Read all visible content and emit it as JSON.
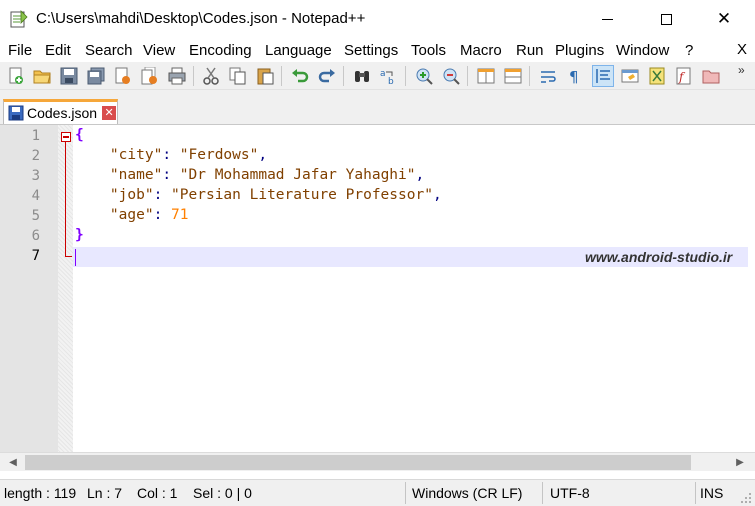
{
  "window": {
    "title": "C:\\Users\\mahdi\\Desktop\\Codes.json - Notepad++"
  },
  "menu": {
    "items": [
      "File",
      "Edit",
      "Search",
      "View",
      "Encoding",
      "Language",
      "Settings",
      "Tools",
      "Macro",
      "Run",
      "Plugins",
      "Window",
      "?"
    ],
    "close": "X"
  },
  "toolbar": {
    "buttons": [
      "new-file",
      "open-file",
      "save",
      "save-all",
      "close",
      "close-all",
      "print",
      "cut",
      "copy",
      "paste",
      "undo",
      "redo",
      "find",
      "replace",
      "zoom-in",
      "zoom-out",
      "sync-vertical",
      "sync-horizontal",
      "word-wrap",
      "show-all-characters",
      "indent-guide",
      "user-defined-language",
      "doc-map",
      "function-list",
      "folder-as-workspace"
    ],
    "more": "»"
  },
  "tab": {
    "label": "Codes.json",
    "close": "✕"
  },
  "editor": {
    "line_numbers": [
      "1",
      "2",
      "3",
      "4",
      "5",
      "6",
      "7"
    ],
    "lines": [
      {
        "parts": [
          {
            "t": "brace",
            "v": "{"
          }
        ]
      },
      {
        "parts": [
          {
            "t": "plain",
            "v": "    "
          },
          {
            "t": "key",
            "v": "\"city\""
          },
          {
            "t": "punct",
            "v": ": "
          },
          {
            "t": "str",
            "v": "\"Ferdows\""
          },
          {
            "t": "punct",
            "v": ","
          }
        ]
      },
      {
        "parts": [
          {
            "t": "plain",
            "v": "    "
          },
          {
            "t": "key",
            "v": "\"name\""
          },
          {
            "t": "punct",
            "v": ": "
          },
          {
            "t": "str",
            "v": "\"Dr Mohammad Jafar Yahaghi\""
          },
          {
            "t": "punct",
            "v": ","
          }
        ]
      },
      {
        "parts": [
          {
            "t": "plain",
            "v": "    "
          },
          {
            "t": "key",
            "v": "\"job\""
          },
          {
            "t": "punct",
            "v": ": "
          },
          {
            "t": "str",
            "v": "\"Persian Literature Professor\""
          },
          {
            "t": "punct",
            "v": ","
          }
        ]
      },
      {
        "parts": [
          {
            "t": "plain",
            "v": "    "
          },
          {
            "t": "key",
            "v": "\"age\""
          },
          {
            "t": "punct",
            "v": ": "
          },
          {
            "t": "num",
            "v": "71"
          }
        ]
      },
      {
        "parts": [
          {
            "t": "brace",
            "v": "}"
          }
        ]
      },
      {
        "parts": []
      }
    ],
    "current_line": 7,
    "watermark": "www.android-studio.ir"
  },
  "status": {
    "length": "length : 119",
    "ln": "Ln : 7",
    "col": "Col : 1",
    "sel": "Sel : 0 | 0",
    "eol": "Windows (CR LF)",
    "encoding": "UTF-8",
    "mode": "INS"
  },
  "colors": {
    "brace": "#8000ff",
    "key": "#804000",
    "string": "#804000",
    "number": "#ff8000",
    "current_line": "#e8e8ff",
    "tab_accent": "#f6a73a"
  }
}
